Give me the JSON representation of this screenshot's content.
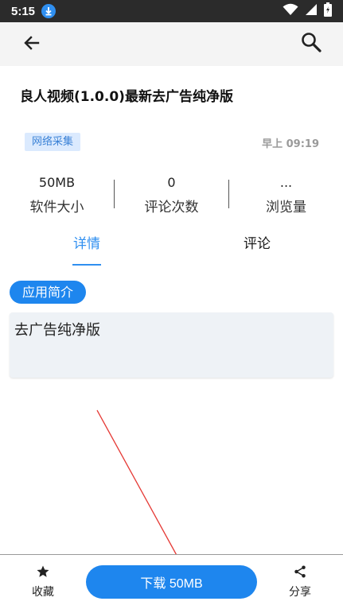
{
  "status_bar": {
    "time": "5:15"
  },
  "app": {
    "title": "良人视频(1.0.0)最新去广告纯净版",
    "tag": "网络采集",
    "time": "早上 09:19"
  },
  "stats": [
    {
      "value": "50MB",
      "label": "软件大小"
    },
    {
      "value": "0",
      "label": "评论次数"
    },
    {
      "value": "...",
      "label": "浏览量"
    }
  ],
  "tabs": [
    {
      "label": "详情",
      "active": true
    },
    {
      "label": "评论",
      "active": false
    }
  ],
  "intro": {
    "heading": "应用简介",
    "text": "去广告纯净版"
  },
  "bottom_bar": {
    "favorite_label": "收藏",
    "download_label": "下载 50MB",
    "share_label": "分享"
  },
  "colors": {
    "accent": "#1e86ee",
    "tag_bg": "#dbeafe",
    "annotation": "#e53935"
  },
  "icons": {
    "back": "arrow-left-icon",
    "search": "search-icon",
    "favorite": "star-icon",
    "share": "share-icon"
  }
}
